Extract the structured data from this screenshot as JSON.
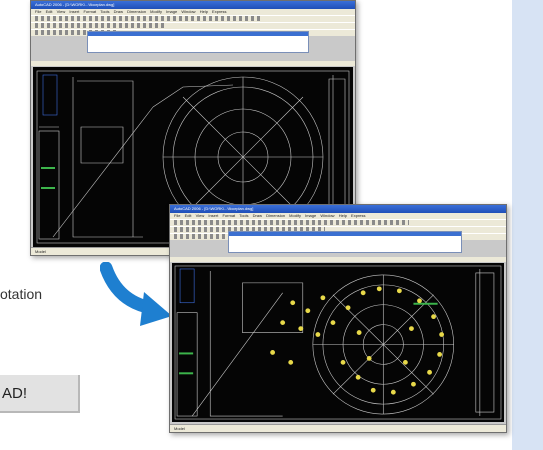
{
  "left_caption": "otation",
  "cta_button": {
    "label": "AD!"
  },
  "colors": {
    "side_panel": "#d7e3f4",
    "arrow": "#1e7fd0",
    "canvas": "#050505",
    "drawing_lines": "#c8c8c8",
    "annotations": "#e8d94a",
    "title_bar": "#2a5fc8"
  },
  "screenshot_before": {
    "title": "AutoCAD 2006 - [D:\\WORK\\...\\floorplan.dwg]",
    "menu": [
      "File",
      "Edit",
      "View",
      "Insert",
      "Format",
      "Tools",
      "Draw",
      "Dimension",
      "Modify",
      "Image",
      "Window",
      "Help",
      "Express"
    ],
    "status": "Model"
  },
  "screenshot_after": {
    "title": "AutoCAD 2006 - [D:\\WORK\\...\\floorplan.dwg]",
    "menu": [
      "File",
      "Edit",
      "View",
      "Insert",
      "Format",
      "Tools",
      "Draw",
      "Dimension",
      "Modify",
      "Image",
      "Window",
      "Help",
      "Express"
    ],
    "status": "Model"
  }
}
